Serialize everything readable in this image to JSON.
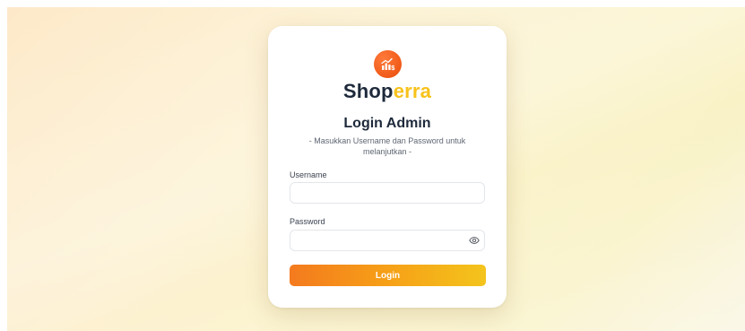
{
  "brand": {
    "name_part1": "Shop",
    "name_part2": "erra",
    "logo_icon": "chart-dollar-icon",
    "primary_color": "#1e2a3b",
    "accent_color": "#f7c21a",
    "logo_color": "#f05a18"
  },
  "login": {
    "title": "Login Admin",
    "subtitle": "- Masukkan Username dan Password untuk melanjutkan -",
    "username_label": "Username",
    "username_value": "",
    "password_label": "Password",
    "password_value": "",
    "password_toggle_icon": "eye-icon",
    "submit_label": "Login",
    "button_gradient": [
      "#f47a1e",
      "#f4c41c"
    ]
  }
}
